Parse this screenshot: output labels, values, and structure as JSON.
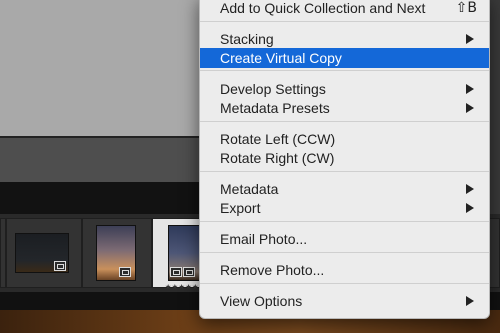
{
  "context_menu": {
    "add_to_quick_collection": {
      "label": "Add to Quick Collection and Next",
      "shortcut": "⇧B"
    },
    "stacking": {
      "label": "Stacking"
    },
    "create_virtual_copy": {
      "label": "Create Virtual Copy"
    },
    "develop_settings": {
      "label": "Develop Settings"
    },
    "metadata_presets": {
      "label": "Metadata Presets"
    },
    "rotate_left": {
      "label": "Rotate Left (CCW)"
    },
    "rotate_right": {
      "label": "Rotate Right (CW)"
    },
    "metadata": {
      "label": "Metadata"
    },
    "export": {
      "label": "Export"
    },
    "email_photo": {
      "label": "Email Photo..."
    },
    "remove_photo": {
      "label": "Remove Photo..."
    },
    "view_options": {
      "label": "View Options"
    }
  },
  "filmstrip": {
    "selected_rating": "★★★★★"
  },
  "colors": {
    "highlight": "#1468d8",
    "menu_background": "#ececec",
    "filmstrip_background": "#2a2a2a"
  },
  "icons": [
    "submenu-arrow-icon",
    "virtual-copy-badge-icon",
    "star-icon"
  ]
}
